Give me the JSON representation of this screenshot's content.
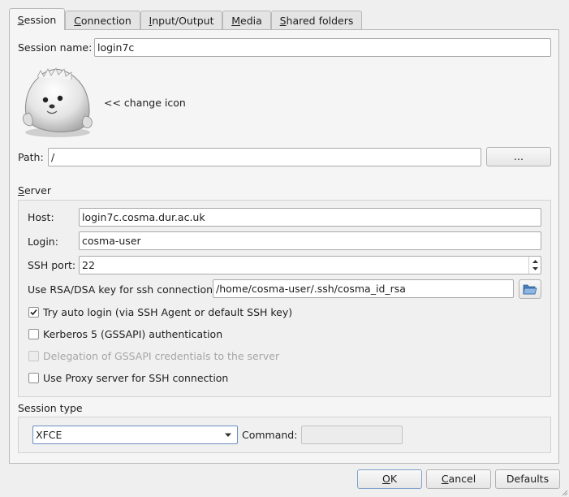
{
  "tabs": [
    {
      "label": "Session",
      "mnemonic": "S",
      "rest": "ession"
    },
    {
      "label": "Connection",
      "mnemonic": "C",
      "rest": "onnection"
    },
    {
      "label": "Input/Output",
      "mnemonic": "I",
      "rest": "nput/Output"
    },
    {
      "label": "Media",
      "mnemonic": "M",
      "rest": "edia"
    },
    {
      "label": "Shared folders",
      "mnemonic": "S",
      "rest": "hared folders"
    }
  ],
  "session": {
    "name_label": "Session name:",
    "name_value": "login7c",
    "change_icon_label": "<< change icon",
    "path_label": "Path:",
    "path_value": "/",
    "browse_label": "..."
  },
  "server": {
    "title_mnemonic": "S",
    "title_rest": "erver",
    "host_label": "Host:",
    "host_value": "login7c.cosma.dur.ac.uk",
    "login_label": "Login:",
    "login_value": "cosma-user",
    "ssh_port_label": "SSH port:",
    "ssh_port_value": "22",
    "rsa_label": "Use RSA/DSA key for ssh connection:",
    "rsa_value": "/home/cosma-user/.ssh/cosma_id_rsa",
    "auto_login_label": "Try auto login (via SSH Agent or default SSH key)",
    "auto_login_checked": true,
    "kerberos_label": "Kerberos 5 (GSSAPI) authentication",
    "kerberos_checked": false,
    "delegation_label": "Delegation of GSSAPI credentials to the server",
    "delegation_checked": false,
    "proxy_label": "Use Proxy server for SSH connection",
    "proxy_checked": false
  },
  "session_type": {
    "title": "Session type",
    "selected": "XFCE",
    "command_label": "Command:",
    "command_value": ""
  },
  "buttons": {
    "ok_mnemonic": "O",
    "ok_rest": "K",
    "cancel_mnemonic": "C",
    "cancel_rest": "ancel",
    "defaults_label": "Defaults"
  }
}
